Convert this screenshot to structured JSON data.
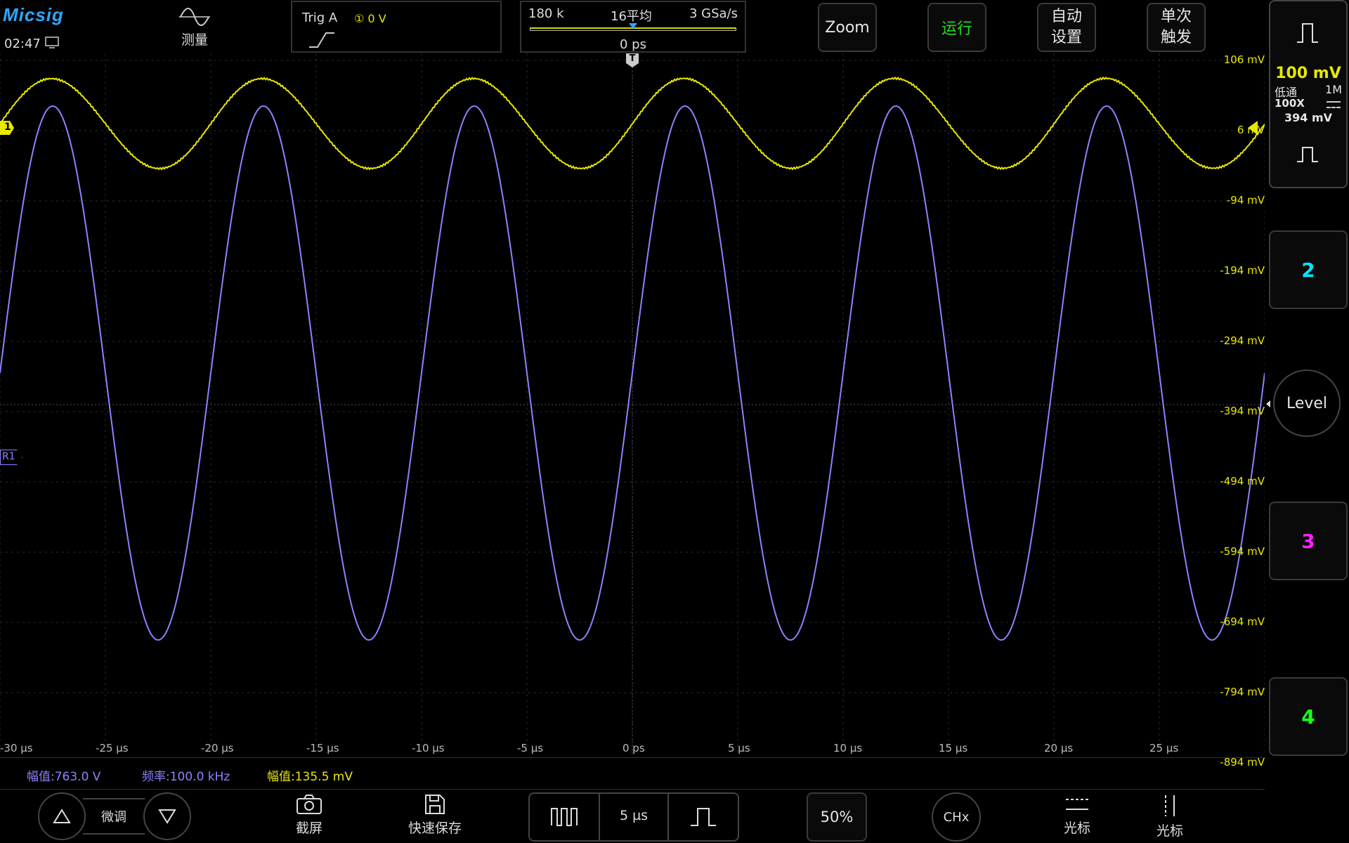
{
  "header": {
    "brand": "Micsig",
    "clock": "02:47",
    "measure_label": "测量",
    "trig_label": "Trig  A",
    "trig_level": "① 0 V",
    "acq": {
      "points": "180 k",
      "avg": "16平均",
      "rate": "3 GSa/s",
      "offset": "0 ps"
    },
    "zoom_label": "Zoom",
    "run_label": "运行",
    "autoset_label": "自动\n设置",
    "single_label": "单次\n触发"
  },
  "right_panel": {
    "ch1_scale": "100 mV",
    "ch1_coupling_mode": "低通",
    "ch1_impedance": "1M",
    "ch1_probe": "100X",
    "ch1_offset": "394 mV",
    "ch2_label": "2",
    "level_label": "Level",
    "ch3_label": "3",
    "ch4_label": "4"
  },
  "y_labels": [
    "106 mV",
    "6 mV",
    "-94 mV",
    "-194 mV",
    "-294 mV",
    "-394 mV",
    "-494 mV",
    "-594 mV",
    "-694 mV",
    "-794 mV",
    "-894 mV"
  ],
  "x_labels": [
    "-30 µs",
    "-25 µs",
    "-20 µs",
    "-15 µs",
    "-10 µs",
    "-5 µs",
    "0 ps",
    "5 µs",
    "10 µs",
    "15 µs",
    "20 µs",
    "25 µs"
  ],
  "markers": {
    "ch1": "1",
    "ref": "R1",
    "trigger": "T"
  },
  "measurements": [
    {
      "text": "幅值:763.0 V",
      "color": "#8a84ff"
    },
    {
      "text": "频率:100.0 kHz",
      "color": "#8a84ff"
    },
    {
      "text": "幅值:135.5 mV",
      "color": "#e8e800"
    }
  ],
  "footer": {
    "fine_label": "微调",
    "screenshot_label": "截屏",
    "quicksave_label": "快速保存",
    "timebase": "5 µs",
    "fifty_label": "50%",
    "chx_label": "CHx",
    "cursor_h_label": "光标",
    "cursor_v_label": "光标"
  },
  "colors": {
    "ch1": "#e8e800",
    "ref": "#8a84ff",
    "ch2": "#00e5ff",
    "ch3": "#ff20ff",
    "ch4": "#19ff19",
    "run": "#22dd22"
  },
  "icons": [
    "sine-wave-icon",
    "monitor-icon",
    "rising-edge-icon",
    "pulse-icon",
    "camera-icon",
    "floppy-icon",
    "up-arrow-icon",
    "down-arrow-icon"
  ]
}
